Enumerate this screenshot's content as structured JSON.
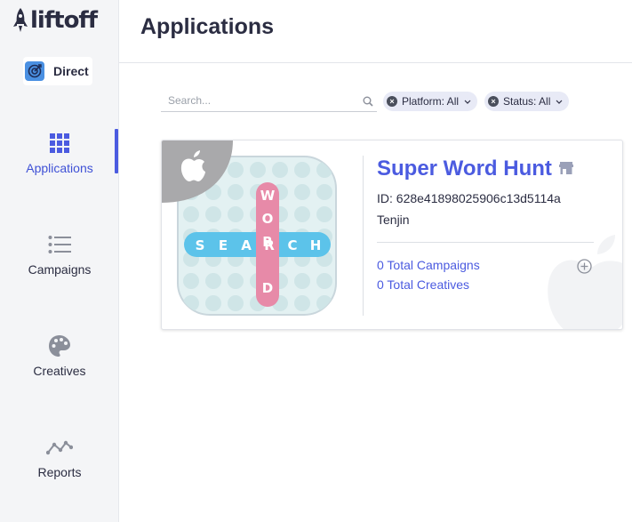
{
  "sidebar": {
    "logo_text": "liftoff",
    "account": {
      "label": "Direct",
      "icon": "target-icon"
    },
    "items": [
      {
        "label": "Applications",
        "icon": "grid-icon",
        "active": true
      },
      {
        "label": "Campaigns",
        "icon": "list-icon",
        "active": false
      },
      {
        "label": "Creatives",
        "icon": "palette-icon",
        "active": false
      },
      {
        "label": "Reports",
        "icon": "trend-line-icon",
        "active": false
      }
    ]
  },
  "header": {
    "title": "Applications"
  },
  "filters": {
    "search_placeholder": "Search...",
    "search_value": "",
    "platform_chip": "Platform: All",
    "status_chip": "Status: All"
  },
  "apps": [
    {
      "name": "Super Word Hunt",
      "id_text": "ID: 628e41898025906c13d5114a",
      "attribution": "Tenjin",
      "platform": "apple-icon",
      "campaigns_link": "0 Total Campaigns",
      "creatives_link": "0 Total Creatives",
      "icon_word_vertical": [
        "W",
        "O",
        "R",
        "D"
      ],
      "icon_word_horizontal": [
        "S",
        "E",
        "A",
        "R",
        "C",
        "H"
      ]
    }
  ],
  "colors": {
    "accent": "#4b5be0",
    "sidebar_bg": "#f4f5f7",
    "chip_bg": "#e8eaf6",
    "icon_bg": "#e3f1f2",
    "pink": "#e78aa8",
    "blue": "#5cc3ea"
  }
}
